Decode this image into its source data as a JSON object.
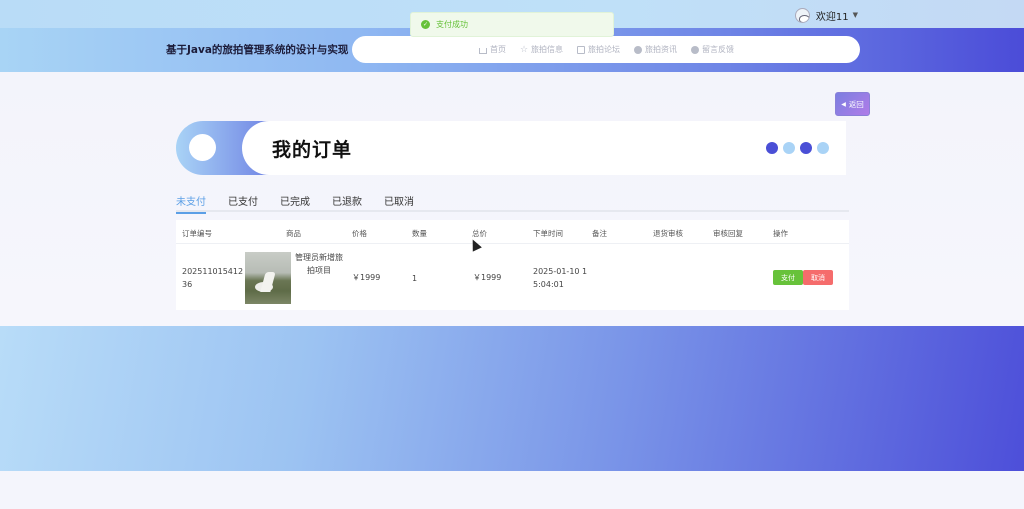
{
  "topbar": {
    "welcome": "欢迎11",
    "caret": "▼"
  },
  "header": {
    "site_title": "基于Java的旅拍管理系统的设计与实现",
    "nav": [
      {
        "label": "首页",
        "icon": "home-icon"
      },
      {
        "label": "旅拍信息",
        "icon": "star-icon"
      },
      {
        "label": "旅拍论坛",
        "icon": "file-icon"
      },
      {
        "label": "旅拍资讯",
        "icon": "dot-icon"
      },
      {
        "label": "留言反馈",
        "icon": "dot-icon"
      }
    ]
  },
  "toast": {
    "message": "支付成功",
    "icon": "check-icon"
  },
  "back_button": {
    "label": "返回",
    "icon": "caret-left-icon"
  },
  "banner": {
    "title": "我的订单",
    "dot_colors": [
      "#4a4fd6",
      "#a9d3f6",
      "#4a4fd6",
      "#a9d3f6"
    ]
  },
  "tabs": [
    {
      "label": "未支付",
      "active": true
    },
    {
      "label": "已支付",
      "active": false
    },
    {
      "label": "已完成",
      "active": false
    },
    {
      "label": "已退款",
      "active": false
    },
    {
      "label": "已取消",
      "active": false
    }
  ],
  "table": {
    "headers": [
      "订单编号",
      "商品",
      "价格",
      "数量",
      "总价",
      "下单时间",
      "备注",
      "退货审核",
      "审核回复",
      "操作"
    ],
    "rows": [
      {
        "order_no_line1": "202511015412",
        "order_no_line2": "36",
        "product_line1": "管理员新增旅",
        "product_line2": "拍项目",
        "price": "￥1999",
        "quantity": "1",
        "total": "￥1999",
        "time_line1": "2025-01-10 1",
        "time_line2": "5:04:01",
        "remark": "",
        "return_review": "",
        "review_reply": "",
        "actions": {
          "pay": "支付",
          "cancel": "取消"
        }
      }
    ]
  },
  "colors": {
    "accent": "#5b9fe6",
    "success": "#67c23a",
    "danger": "#f56c6c",
    "brand_gradient_end": "#4b4cd8"
  }
}
